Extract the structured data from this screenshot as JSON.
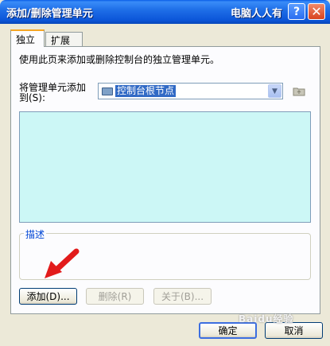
{
  "window": {
    "title": "添加/删除管理单元",
    "watermark": "电脑人人有",
    "help_label": "?",
    "close_label": "✕"
  },
  "tabs": [
    {
      "label": "独立",
      "active": true
    },
    {
      "label": "扩展",
      "active": false
    }
  ],
  "standalone": {
    "description": "使用此页来添加或删除控制台的独立管理单元。",
    "add_to_label_line1": "将管理单元添加",
    "add_to_label_line2": "到(S):",
    "combo_value": "控制台根节点",
    "combo_arrow": "▼"
  },
  "description_group": {
    "legend": "描述"
  },
  "buttons": {
    "add": "添加(D)...",
    "remove": "删除(R)",
    "about": "关于(B)...",
    "ok": "确定",
    "cancel": "取消"
  },
  "colors": {
    "titlebar": "#0b55d8",
    "list_background": "#ccf7f6",
    "selection": "#316ac5",
    "annotation_arrow": "#e21b1b"
  },
  "icons": {
    "combo": "folder-icon",
    "browse": "folder-up-icon",
    "annotation": "red-arrow-icon"
  },
  "bottom_watermark": "Baidu经验"
}
